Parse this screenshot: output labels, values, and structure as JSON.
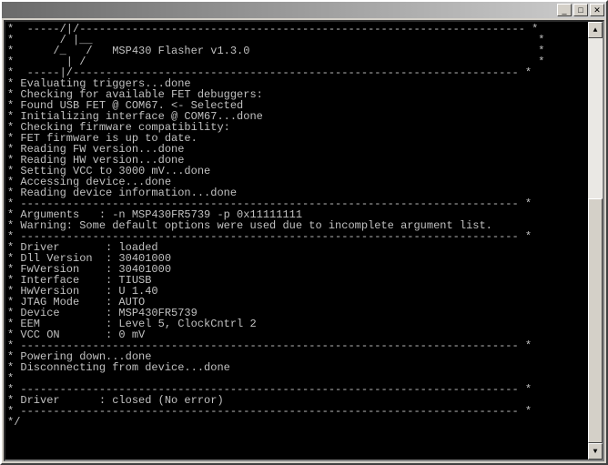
{
  "titlebar": {
    "minimize": "_",
    "maximize": "□",
    "close": "✕"
  },
  "banner": {
    "line1": "*  -----/|/-------------------------------------------------------------------- *",
    "line2": "*       / |__                                                                    *",
    "line3": "*      /_   /   MSP430 Flasher v1.3.0                                            *",
    "line4": "*        | /                                                                     *",
    "line5": "*  -----|/-------------------------------------------------------------------- *"
  },
  "log": {
    "l01": "* Evaluating triggers...done",
    "l02": "* Checking for available FET debuggers:",
    "l03": "* Found USB FET @ COM67. <- Selected",
    "l04": "* Initializing interface @ COM67...done",
    "l05": "* Checking firmware compatibility:",
    "l06": "* FET firmware is up to date.",
    "l07": "* Reading FW version...done",
    "l08": "* Reading HW version...done",
    "l09": "* Setting VCC to 3000 mV...done",
    "l10": "* Accessing device...done",
    "l11": "* Reading device information...done",
    "sep1": "* ---------------------------------------------------------------------------- *",
    "arg": "* Arguments   : -n MSP430FR5739 -p 0x11111111",
    "warn": "* Warning: Some default options were used due to incomplete argument list.",
    "sep2": "* ---------------------------------------------------------------------------- *",
    "d1": "* Driver       : loaded",
    "d2": "* Dll Version  : 30401000",
    "d3": "* FwVersion    : 30401000",
    "d4": "* Interface    : TIUSB",
    "d5": "* HwVersion    : U 1.40",
    "d6": "* JTAG Mode    : AUTO",
    "d7": "* Device       : MSP430FR5739",
    "d8": "* EEM          : Level 5, ClockCntrl 2",
    "d9": "* VCC ON       : 0 mV",
    "sep3": "* ---------------------------------------------------------------------------- *",
    "p1": "* Powering down...done",
    "p2": "* Disconnecting from device...done",
    "sep4": "*                                                                                ",
    "sep5": "* ---------------------------------------------------------------------------- *",
    "c1": "* Driver      : closed (No error)",
    "sep6": "* ---------------------------------------------------------------------------- *",
    "end": "*/"
  }
}
